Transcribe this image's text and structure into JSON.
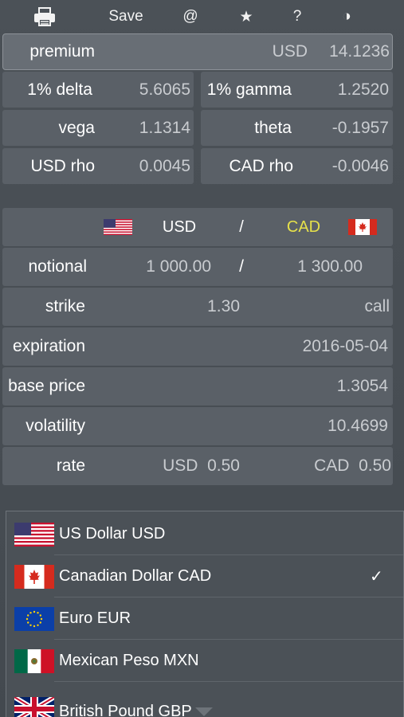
{
  "toolbar": {
    "print_icon": "printer-icon",
    "save_label": "Save",
    "at_label": "@",
    "star_label": "★",
    "help_label": "?",
    "theme_label": "◑"
  },
  "greeks": {
    "premium_label": "premium",
    "premium_currency": "USD",
    "premium_value": "14.1236",
    "delta_label": "1% delta",
    "delta_value": "5.6065",
    "gamma_label": "1% gamma",
    "gamma_value": "1.2520",
    "vega_label": "vega",
    "vega_value": "1.1314",
    "theta_label": "theta",
    "theta_value": "-0.1957",
    "usd_rho_label": "USD rho",
    "usd_rho_value": "0.0045",
    "cad_rho_label": "CAD rho",
    "cad_rho_value": "-0.0046"
  },
  "pair": {
    "base": "USD",
    "slash": "/",
    "quote": "CAD",
    "quote_color": "#e6e14a"
  },
  "inputs": {
    "notional_label": "notional",
    "notional_base": "1 000.00",
    "notional_slash": "/",
    "notional_quote": "1 300.00",
    "strike_label": "strike",
    "strike_value": "1.30",
    "option_type": "call",
    "expiration_label": "expiration",
    "expiration_value": "2016-05-04",
    "base_price_label": "base price",
    "base_price_value": "1.3054",
    "volatility_label": "volatility",
    "volatility_value": "10.4699",
    "rate_label": "rate",
    "rate_usd": "USD  0.50",
    "rate_cad": "CAD  0.50"
  },
  "currency_list": {
    "items": [
      {
        "name": "US Dollar USD",
        "flag": "us-flag-icon",
        "selected": false
      },
      {
        "name": "Canadian Dollar CAD",
        "flag": "canada-flag-icon",
        "selected": true
      },
      {
        "name": "Euro EUR",
        "flag": "eu-flag-icon",
        "selected": false
      },
      {
        "name": "Mexican Peso MXN",
        "flag": "mexico-flag-icon",
        "selected": false
      },
      {
        "name": "British Pound GBP",
        "flag": "uk-flag-icon",
        "selected": false
      }
    ],
    "check_mark": "✓"
  }
}
